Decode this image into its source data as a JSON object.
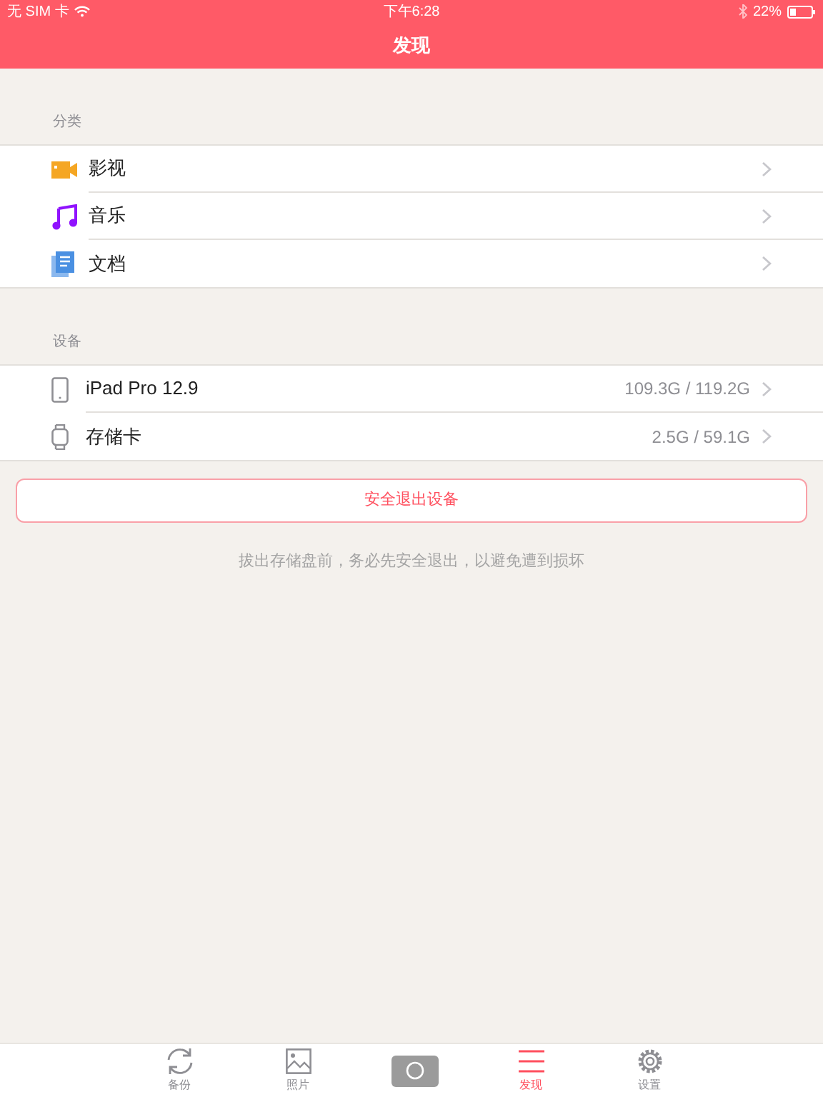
{
  "status_bar": {
    "carrier": "无 SIM 卡",
    "time": "下午6:28",
    "battery": "22%"
  },
  "nav": {
    "title": "发现"
  },
  "categories": {
    "header": "分类",
    "items": [
      {
        "kind": "video",
        "label": "影视"
      },
      {
        "kind": "music",
        "label": "音乐"
      },
      {
        "kind": "document",
        "label": "文档"
      }
    ]
  },
  "devices": {
    "header": "设备",
    "items": [
      {
        "kind": "tablet",
        "label": "iPad Pro 12.9",
        "usage": "109.3G / 119.2G"
      },
      {
        "kind": "card",
        "label": "存储卡",
        "usage": "2.5G / 59.1G"
      }
    ]
  },
  "eject_button": "安全退出设备",
  "note": "拔出存储盘前，务必先安全退出，以避免遭到损坏",
  "tab_bar": [
    {
      "kind": "backup",
      "label": "备份",
      "selected": false
    },
    {
      "kind": "photos",
      "label": "照片",
      "selected": false
    },
    {
      "kind": "camera",
      "selected": false
    },
    {
      "kind": "discover",
      "label": "发现",
      "selected": true
    },
    {
      "kind": "settings",
      "label": "设置",
      "selected": false
    }
  ]
}
